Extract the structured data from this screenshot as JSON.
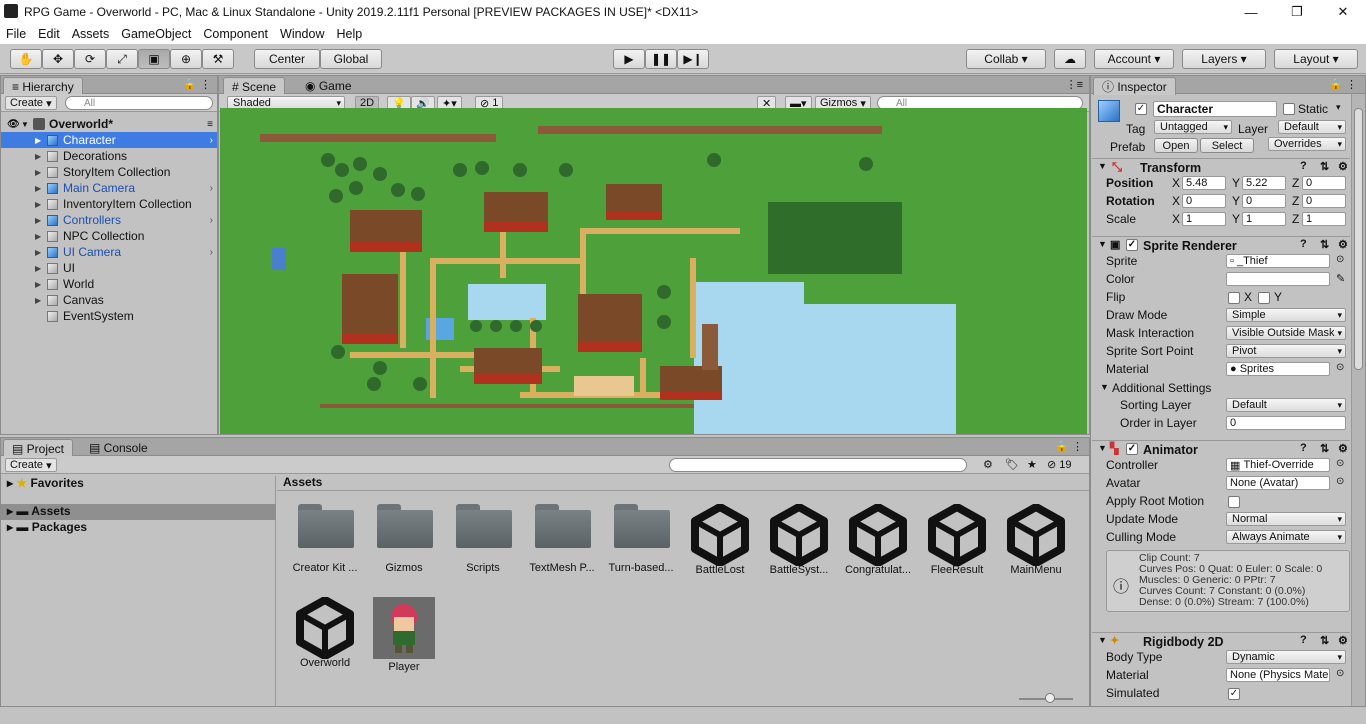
{
  "window": {
    "title": "RPG Game - Overworld - PC, Mac & Linux Standalone - Unity 2019.2.11f1 Personal [PREVIEW PACKAGES IN USE]* <DX11>",
    "minimize": "—",
    "maximize": "❐",
    "close": "✕"
  },
  "menu": [
    "File",
    "Edit",
    "Assets",
    "GameObject",
    "Component",
    "Window",
    "Help"
  ],
  "toolbar": {
    "center": "Center",
    "global": "Global",
    "collab": "Collab",
    "account": "Account",
    "layers": "Layers",
    "layout": "Layout"
  },
  "hierarchy": {
    "tab": "Hierarchy",
    "create": "Create",
    "search_placeholder": "All",
    "scene": "Overworld*",
    "items": [
      {
        "label": "Character",
        "blue": true
      },
      {
        "label": "Decorations",
        "blue": false
      },
      {
        "label": "StoryItem Collection",
        "blue": false
      },
      {
        "label": "Main Camera",
        "blue": true
      },
      {
        "label": "InventoryItem Collection",
        "blue": false
      },
      {
        "label": "Controllers",
        "blue": true
      },
      {
        "label": "NPC Collection",
        "blue": false
      },
      {
        "label": "UI Camera",
        "blue": true
      },
      {
        "label": "UI",
        "blue": false
      },
      {
        "label": "World",
        "blue": false
      },
      {
        "label": "Canvas",
        "blue": false
      },
      {
        "label": "EventSystem",
        "blue": false
      }
    ]
  },
  "scene": {
    "tab_scene": "Scene",
    "tab_game": "Game",
    "shading": "Shaded",
    "mode2d": "2D",
    "hidden_count": "1",
    "gizmos": "Gizmos",
    "search_placeholder": "All"
  },
  "project": {
    "tab_project": "Project",
    "tab_console": "Console",
    "create": "Create",
    "count": "19",
    "favorites": "Favorites",
    "assets": "Assets",
    "packages": "Packages",
    "breadcrumb": "Assets",
    "items": [
      {
        "label": "Creator Kit ...",
        "kind": "folder"
      },
      {
        "label": "Gizmos",
        "kind": "folder"
      },
      {
        "label": "Scripts",
        "kind": "folder"
      },
      {
        "label": "TextMesh P...",
        "kind": "folder"
      },
      {
        "label": "Turn-based...",
        "kind": "folder"
      },
      {
        "label": "BattleLost",
        "kind": "unity"
      },
      {
        "label": "BattleSyst...",
        "kind": "unity"
      },
      {
        "label": "Congratulat...",
        "kind": "unity"
      },
      {
        "label": "FleeResult",
        "kind": "unity"
      },
      {
        "label": "MainMenu",
        "kind": "unity"
      },
      {
        "label": "Overworld",
        "kind": "unity"
      },
      {
        "label": "Player",
        "kind": "sprite"
      }
    ]
  },
  "inspector": {
    "tab": "Inspector",
    "name": "Character",
    "static": "Static",
    "tag_label": "Tag",
    "tag": "Untagged",
    "layer_label": "Layer",
    "layer": "Default",
    "prefab_label": "Prefab",
    "open": "Open",
    "select": "Select",
    "overrides": "Overrides",
    "transform": {
      "title": "Transform",
      "position": "Position",
      "rotation": "Rotation",
      "scale": "Scale",
      "pos": [
        "5.48",
        "5.22",
        "0"
      ],
      "rot": [
        "0",
        "0",
        "0"
      ],
      "scl": [
        "1",
        "1",
        "1"
      ]
    },
    "sprite_renderer": {
      "title": "Sprite Renderer",
      "sprite_label": "Sprite",
      "sprite": "_Thief",
      "color_label": "Color",
      "flip_label": "Flip",
      "flip_x": "X",
      "flip_y": "Y",
      "draw_mode_label": "Draw Mode",
      "draw_mode": "Simple",
      "mask_label": "Mask Interaction",
      "mask": "Visible Outside Mask",
      "sort_point_label": "Sprite Sort Point",
      "sort_point": "Pivot",
      "material_label": "Material",
      "material": "Sprites",
      "additional": "Additional Settings",
      "sorting_layer_label": "Sorting Layer",
      "sorting_layer": "Default",
      "order_label": "Order in Layer",
      "order": "0"
    },
    "animator": {
      "title": "Animator",
      "controller_label": "Controller",
      "controller": "Thief-Override",
      "avatar_label": "Avatar",
      "avatar": "None (Avatar)",
      "root_motion_label": "Apply Root Motion",
      "update_label": "Update Mode",
      "update": "Normal",
      "culling_label": "Culling Mode",
      "culling": "Always Animate",
      "info": [
        "Clip Count: 7",
        "Curves Pos: 0 Quat: 0 Euler: 0 Scale: 0",
        "Muscles: 0 Generic: 0 PPtr: 7",
        "Curves Count: 7 Constant: 0 (0.0%)",
        "Dense: 0 (0.0%) Stream: 7 (100.0%)"
      ]
    },
    "rigidbody": {
      "title": "Rigidbody 2D",
      "body_type_label": "Body Type",
      "body_type": "Dynamic",
      "material_label": "Material",
      "material": "None (Physics Mate",
      "simulated_label": "Simulated"
    }
  }
}
